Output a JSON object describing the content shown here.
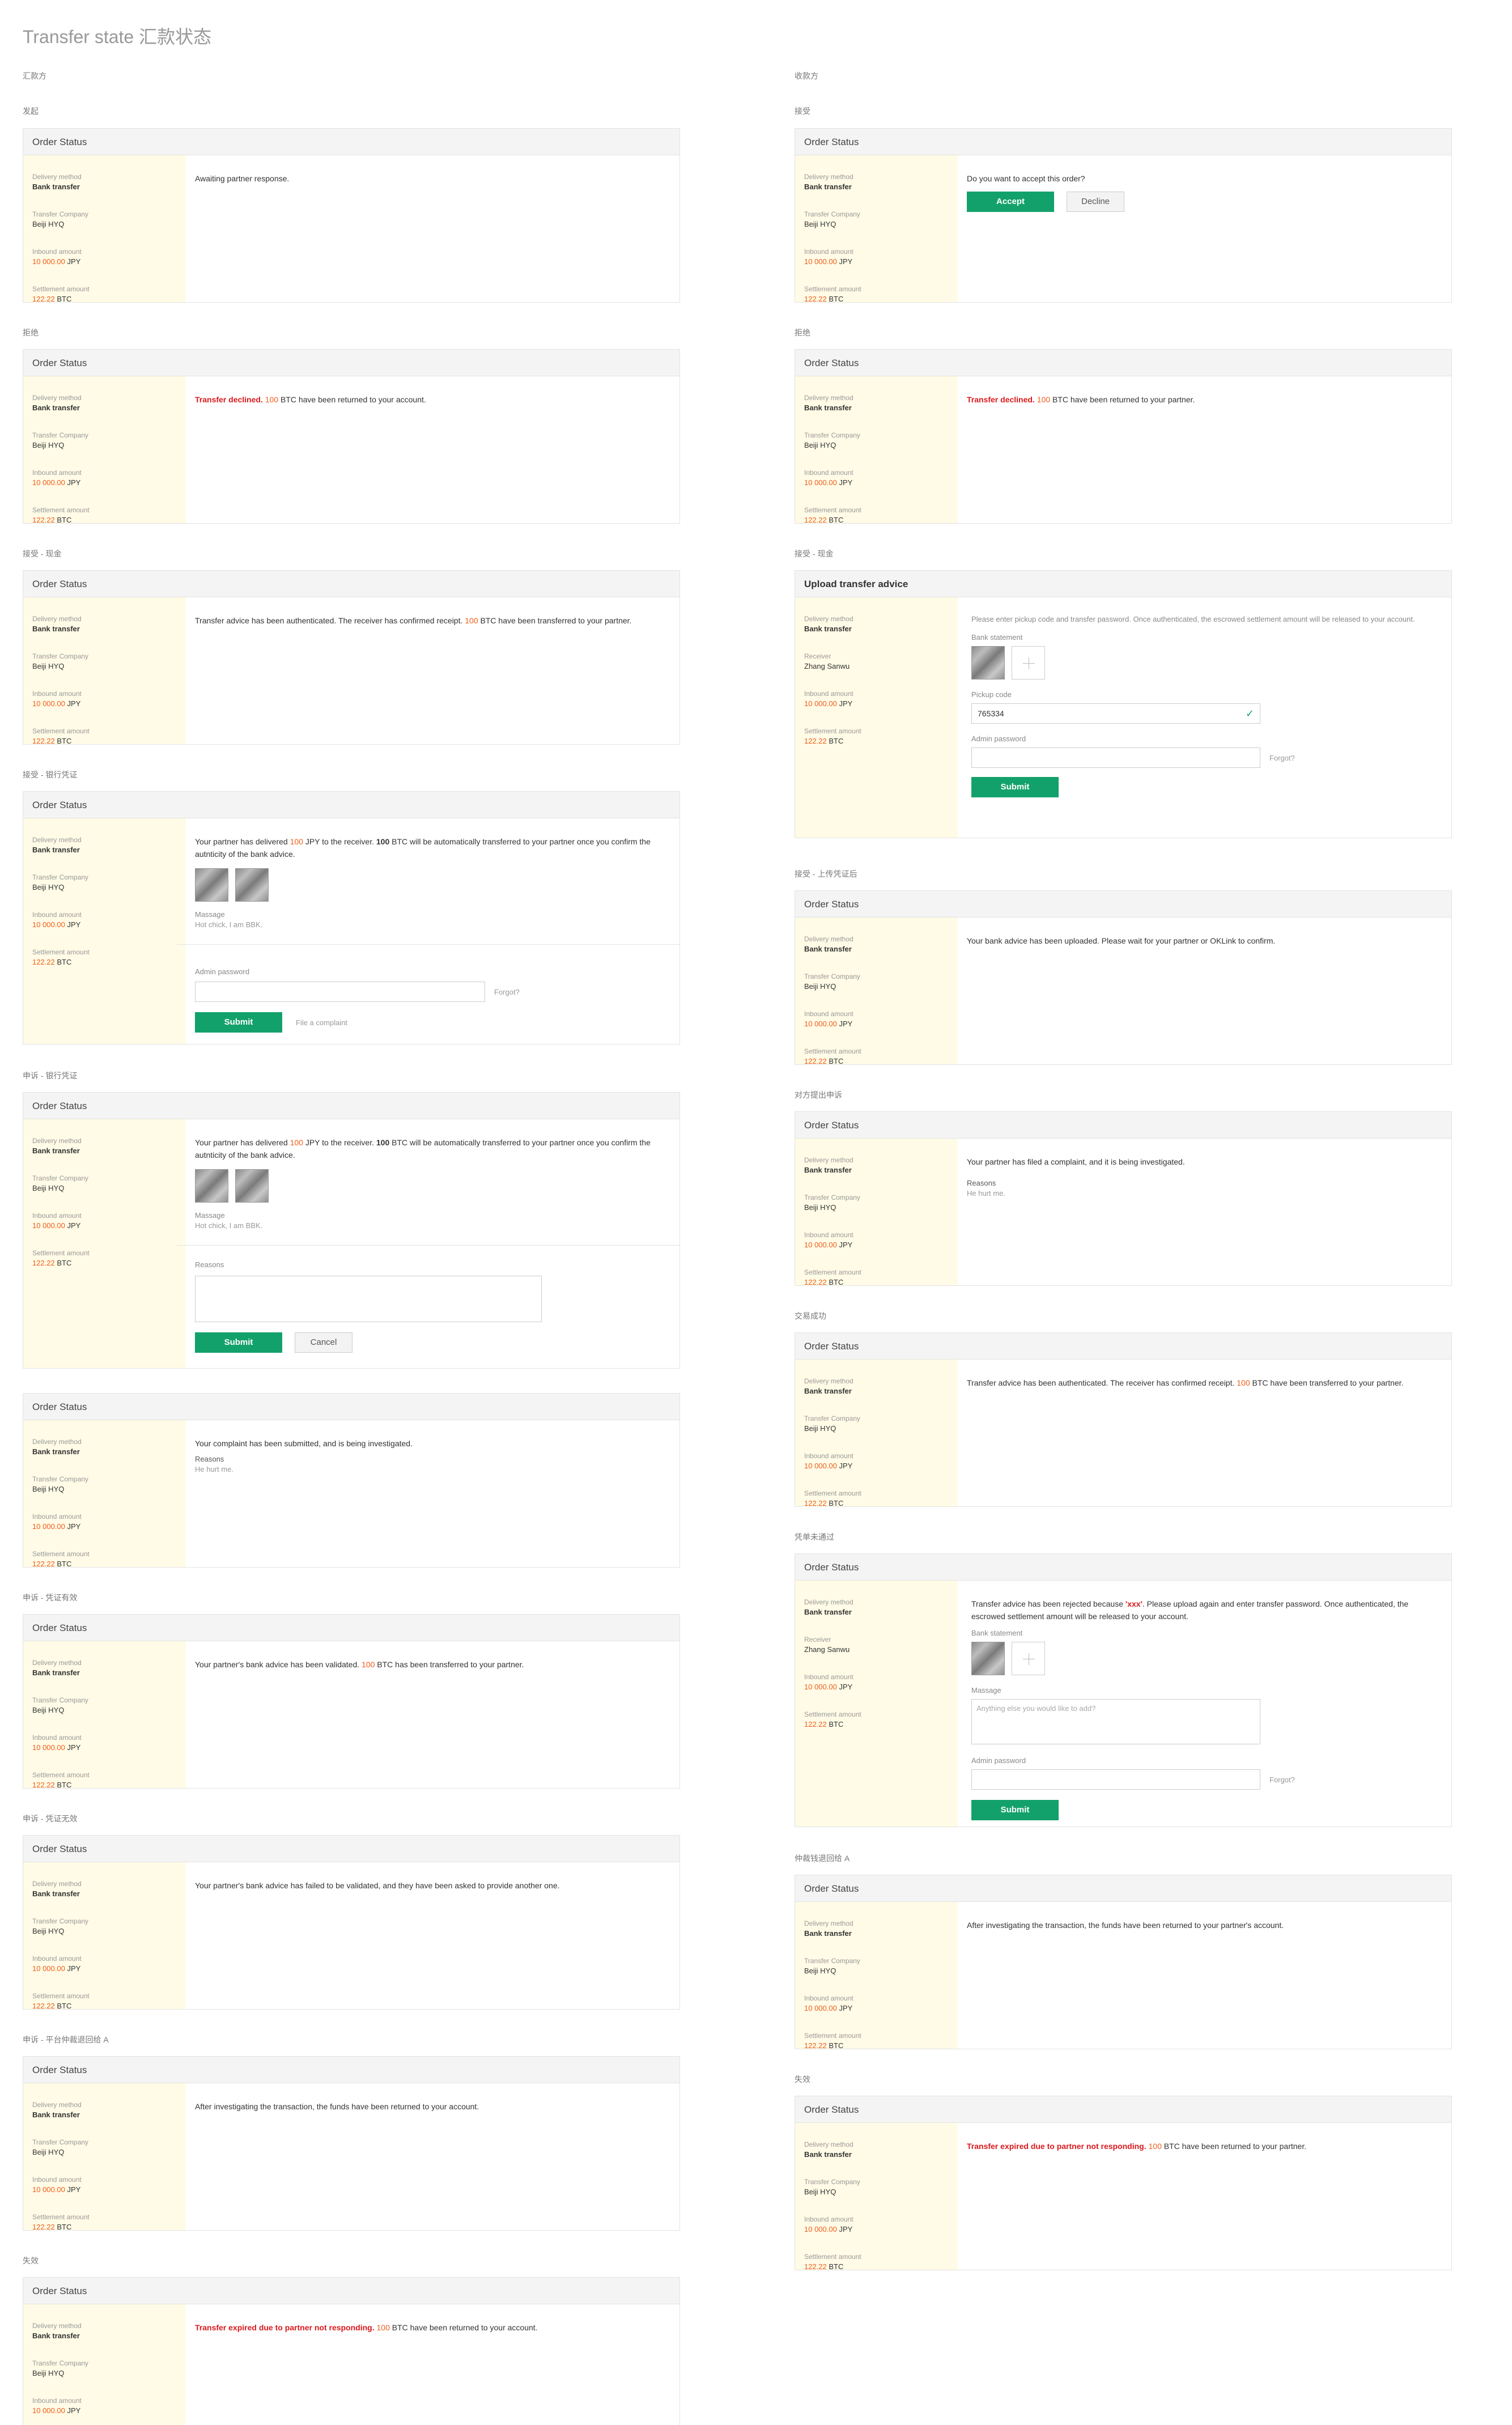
{
  "page_title": "Transfer state 汇款状态",
  "left_column_heading": "汇款方",
  "right_column_heading": "收款方",
  "common": {
    "order_status": "Order Status",
    "delivery_method_label": "Delivery method",
    "delivery_method_value": "Bank transfer",
    "transfer_company_label": "Transfer Company",
    "transfer_company_value": "Beiji HYQ",
    "receiver_label": "Receiver",
    "receiver_value": "Zhang Sanwu",
    "inbound_label": "Inbound amount",
    "inbound_number": "10 000.00",
    "inbound_unit": "JPY",
    "settlement_label": "Settlement amount",
    "settlement_number": "122.22",
    "settlement_unit": "BTC",
    "submit": "Submit",
    "cancel": "Cancel",
    "forgot": "Forgot?",
    "admin_password_label": "Admin password",
    "massage_label": "Massage",
    "massage_value": "Hot chick, I am BBK.",
    "reasons_label": "Reasons",
    "reasons_value": "He hurt me.",
    "bank_statement_label": "Bank statement",
    "message_label": "Massage"
  },
  "left": {
    "s1": {
      "label": "发起",
      "msg": "Awaiting partner response."
    },
    "s2": {
      "label": "拒绝",
      "red": "Transfer declined.",
      "num": "100",
      "rest": " BTC have been returned to your account."
    },
    "s3": {
      "label": "接受 - 现金",
      "pre": "Transfer advice has been authenticated. The receiver has confirmed receipt. ",
      "num": "100",
      "rest": " BTC have been transferred to your partner."
    },
    "s4": {
      "label": "接受 - 银行凭证",
      "pre": "Your partner has delivered ",
      "num": "100",
      "mid1": " JPY to the receiver. ",
      "num2": "100",
      "mid2": " BTC will be automatically transferred to your partner once you confirm the autnticity of the bank advice.",
      "complaint": "File a complaint"
    },
    "s5": {
      "label": "申诉 - 银行凭证",
      "pre": "Your partner has delivered ",
      "num": "100",
      "mid1": " JPY to the receiver. ",
      "num2": "100",
      "mid2": " BTC will be automatically transferred to your partner once you confirm the autnticity of the bank advice."
    },
    "s6": {
      "msg": "Your complaint has been submitted, and is being investigated."
    },
    "s7": {
      "label": "申诉 - 凭证有效",
      "pre": "Your partner's bank advice has been validated. ",
      "num": "100",
      "rest": " BTC has been transferred to your partner."
    },
    "s8": {
      "label": "申诉 - 凭证无效",
      "msg": "Your partner's bank advice has failed to be validated, and they have been asked to provide another one."
    },
    "s9": {
      "label": "申诉 - 平台仲裁退回给 A",
      "msg": "After investigating the transaction, the funds have been returned to your account."
    },
    "s10": {
      "label": "失效",
      "red": "Transfer expired due to partner not responding.",
      "num": "100",
      "rest": " BTC have been returned to your account."
    }
  },
  "right": {
    "s1": {
      "label": "接受",
      "msg": "Do you want to accept this order?",
      "accept": "Accept",
      "decline": "Decline"
    },
    "s2": {
      "label": "拒绝",
      "red": "Transfer declined.",
      "num": "100",
      "rest": " BTC have been returned to your partner."
    },
    "s3": {
      "label": "接受 - 现金",
      "head": "Upload transfer advice",
      "msg": "Please enter pickup code and transfer password. Once authenticated, the escrowed settlement amount will be released to your account.",
      "pickup_label": "Pickup code",
      "pickup_value": "765334"
    },
    "s4": {
      "label": "接受 - 上传凭证后",
      "msg": "Your bank advice has been uploaded. Please wait for your partner or OKLink to confirm."
    },
    "s5": {
      "label": "对方提出申诉",
      "msg": "Your partner has filed a complaint, and it is being investigated."
    },
    "s6": {
      "label": "交易成功",
      "pre": "Transfer advice has been authenticated. The receiver has confirmed receipt. ",
      "num": "100",
      "rest": " BTC have been transferred to your partner."
    },
    "s7": {
      "label": "凭单未通过",
      "pre": "Transfer advice has been rejected because ",
      "red": "'xxx'",
      "rest": ". Please upload again and enter transfer password. Once authenticated, the escrowed settlement amount will be released to your account.",
      "placeholder": "Anything else you would like to add?"
    },
    "s8": {
      "label": "仲裁钱退回给 A",
      "msg": "After investigating the transaction, the funds have been returned to your partner's account."
    },
    "s9": {
      "label": "失效",
      "red": "Transfer expired due to partner not responding.",
      "num": "100",
      "rest": " BTC have been returned to your partner."
    }
  }
}
